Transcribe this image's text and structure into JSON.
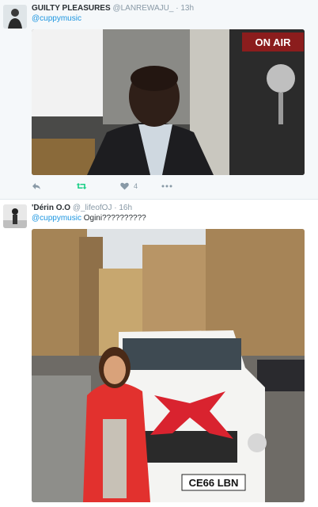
{
  "tweets": [
    {
      "name": "GUILTY PLEASURES",
      "handle": "@LANREWAJU_",
      "separator": "·",
      "time": "13h",
      "mention": "@cuppymusic",
      "text": "",
      "actions": {
        "likes": "4"
      },
      "on_air_sign": "ON AIR"
    },
    {
      "name": "'Dérin O.O",
      "handle": "@_lifeofOJ",
      "separator": "·",
      "time": "16h",
      "mention": "@cuppymusic",
      "text": " Ogini??????????",
      "plate": "CE66 LBN"
    }
  ],
  "colors": {
    "link": "#1b95e0",
    "muted": "#8899a6",
    "retweet": "#19cf86",
    "bow": "#d9232f"
  },
  "icons": [
    "reply-icon",
    "retweet-icon",
    "heart-icon",
    "more-icon"
  ]
}
